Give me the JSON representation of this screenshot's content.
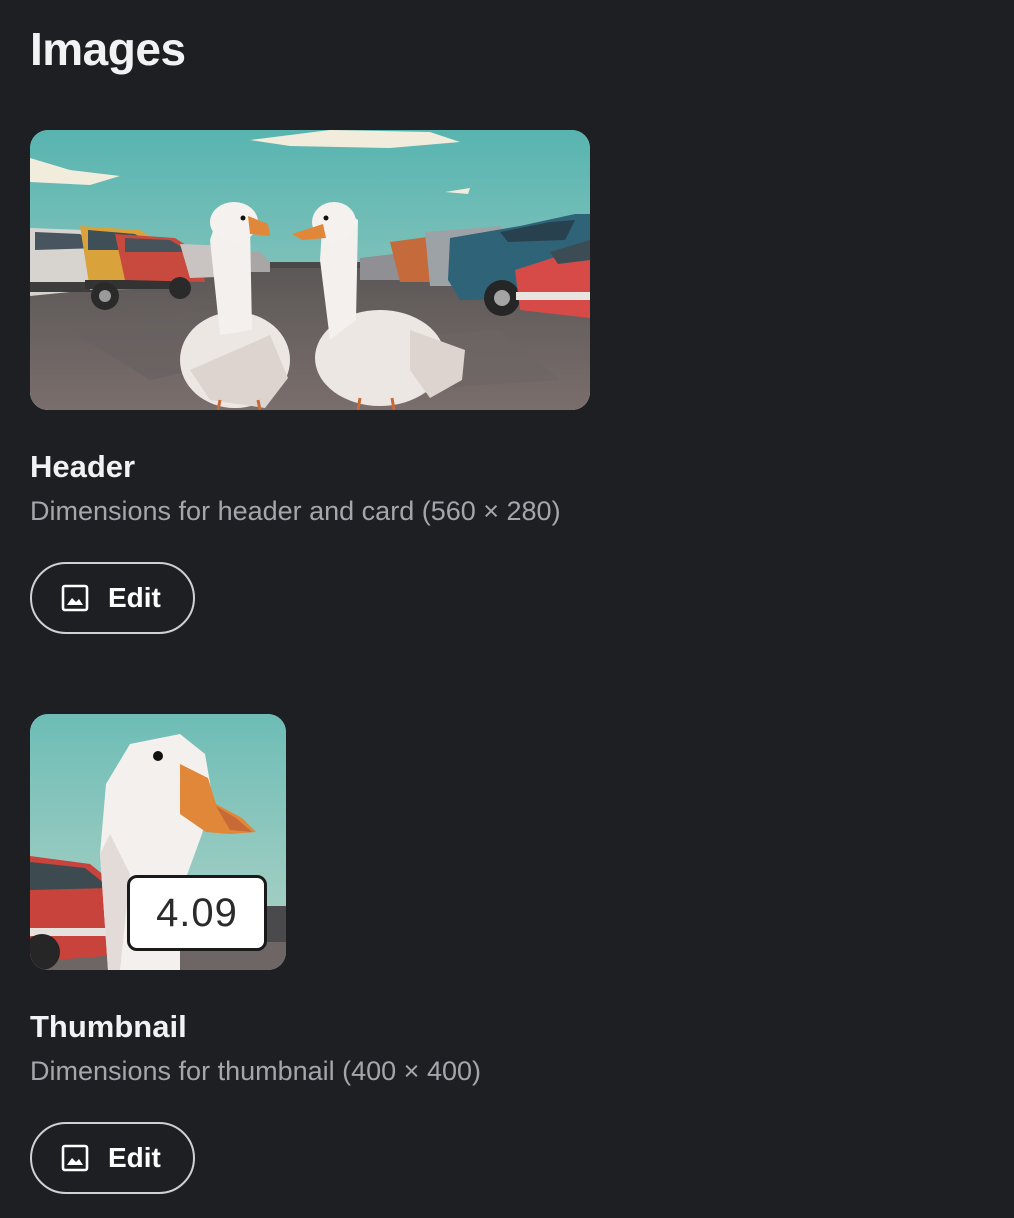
{
  "page": {
    "title": "Images"
  },
  "images": [
    {
      "title": "Header",
      "description": "Dimensions for header and card (560 × 280)",
      "edit_label": "Edit",
      "icon": "image-icon"
    },
    {
      "title": "Thumbnail",
      "description": "Dimensions for thumbnail (400 × 400)",
      "edit_label": "Edit",
      "icon": "image-icon",
      "overlay_label": "4.09"
    }
  ],
  "colors": {
    "background": "#1e1f22",
    "text": "#f1f2f4",
    "muted_text": "#a4a6ab",
    "button_border": "#d0d1d4"
  }
}
